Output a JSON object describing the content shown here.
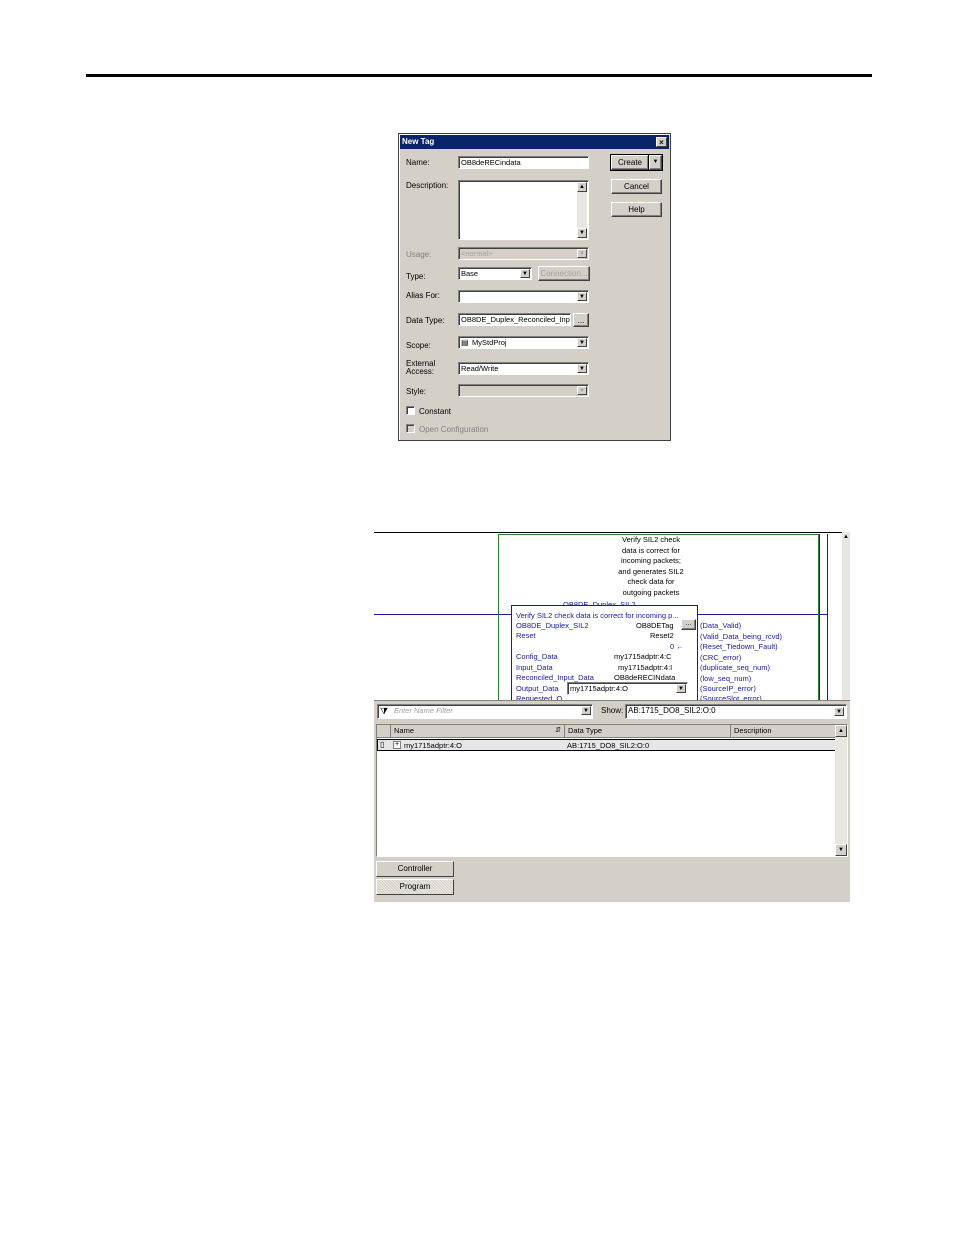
{
  "dialog": {
    "title": "New Tag",
    "close_glyph": "×",
    "labels": {
      "name": "Name:",
      "description": "Description:",
      "usage": "Usage:",
      "type": "Type:",
      "alias_for": "Alias For:",
      "data_type": "Data Type:",
      "scope": "Scope:",
      "external_access_line1": "External",
      "external_access_line2": "Access:",
      "style": "Style:",
      "constant": "Constant",
      "open_configuration": "Open Configuration"
    },
    "values": {
      "name": "OB8deRECindata",
      "description": "",
      "usage": "<normal>",
      "type": "Base",
      "alias_for": "",
      "data_type": "OB8DE_Duplex_Reconciled_Inp",
      "scope": "MyStdProj",
      "external_access": "Read/Write",
      "style": ""
    },
    "buttons": {
      "create": "Create",
      "cancel": "Cancel",
      "help": "Help",
      "connection": "Connection...",
      "browse": "..."
    }
  },
  "ladder": {
    "rung_comment": [
      "Verify SIL2 check",
      "data is correct for",
      "incoming packets;",
      "and generates SIL2",
      "check data for",
      "outgoing packets"
    ],
    "instruction": {
      "name": "OB8DE_Duplex_SIL2",
      "description": "Verify SIL2 check data is correct for incoming p...",
      "params": [
        {
          "name": "OB8DE_Duplex_SIL2",
          "value": "OB8DETag"
        },
        {
          "name": "Reset",
          "value": "Reset2"
        },
        {
          "name": "",
          "value": "0 ←"
        },
        {
          "name": "Config_Data",
          "value": "my1715adptr:4:C"
        },
        {
          "name": "Input_Data",
          "value": "my1715adptr:4:I"
        },
        {
          "name": "Reconciled_Input_Data",
          "value": "OB8deRECINdata"
        },
        {
          "name": "Output_Data",
          "value": "my1715adptr:4:O"
        },
        {
          "name": "Requested_O...",
          "value": ""
        }
      ],
      "outputs": [
        "(Data_Valid)",
        "(Valid_Data_being_rcvd)",
        "(Reset_Tiedown_Fault)",
        "(CRC_error)",
        "(duplicate_seq_num)",
        "(low_seq_num)",
        "(SourceIP_error)",
        "(SourceSlot_error)"
      ]
    }
  },
  "tag_browser": {
    "filter_placeholder": "Enter Name Filter",
    "show_label": "Show:",
    "show_value": "AB:1715_DO8_SIL2:O:0",
    "columns": [
      "Name",
      "Data Type",
      "Description"
    ],
    "rows": [
      {
        "expander": "+",
        "name": "my1715adptr:4:O",
        "data_type": "AB:1715_DO8_SIL2:O:0",
        "description": ""
      }
    ],
    "scope_buttons": [
      "Controller",
      "Program"
    ]
  }
}
